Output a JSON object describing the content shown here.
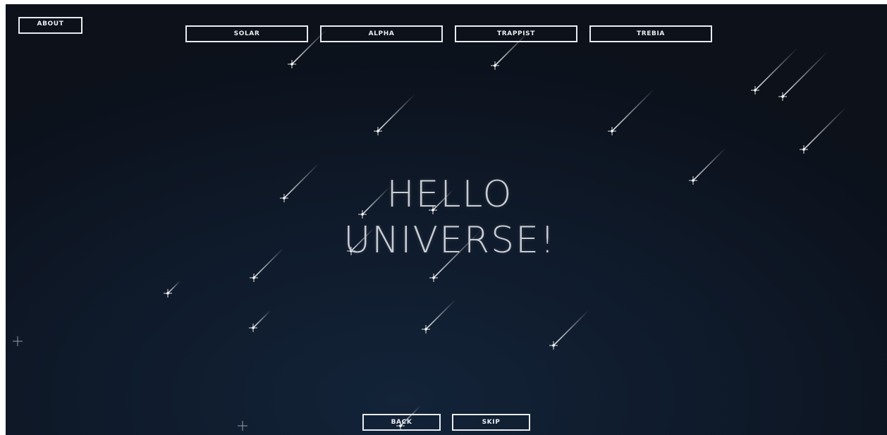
{
  "about": {
    "label": "ABOUT"
  },
  "nav": {
    "items": [
      {
        "id": "solar",
        "label": "SOLAR"
      },
      {
        "id": "alpha",
        "label": "ALPHA"
      },
      {
        "id": "trappist",
        "label": "TRAPPIST"
      },
      {
        "id": "trebia",
        "label": "TREBIA"
      }
    ]
  },
  "hero": {
    "line1": "HELLO",
    "line2": "UNIVERSE!"
  },
  "footer": {
    "back_label": "BACK",
    "skip_label": "SKIP"
  },
  "colors": {
    "button_border": "#e8ecf2",
    "headline": "#c9ccd2",
    "background": "#0f1b2c"
  },
  "icons": {
    "shooting_star": "shooting-star-icon",
    "sparkle": "sparkle-icon"
  }
}
